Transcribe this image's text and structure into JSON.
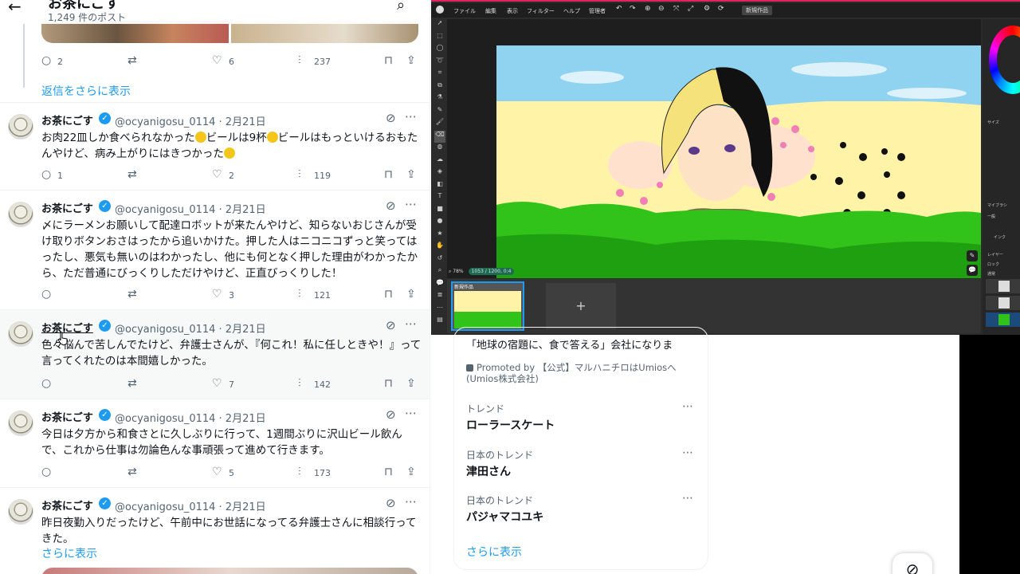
{
  "timeline": {
    "back_icon": "arrow-left-icon",
    "title": "お茶にごす",
    "post_count": "1,249 件のポスト",
    "search_icon": "search-icon",
    "top_actions": {
      "reply": "2",
      "repost": "",
      "like": "6",
      "views": "237"
    },
    "show_more_replies": "返信をさらに表示",
    "tweets": [
      {
        "name": "お茶にごす",
        "handle": "@ocyanigosu_0114 · 2月21日",
        "text_parts": [
          "お肉22皿しか食べられなかった",
          "ビールは9杯",
          "ビールはもっといけるおもたんやけど、病み上がりにはきつかった",
          ""
        ],
        "reply": "1",
        "repost": "",
        "like": "2",
        "views": "119"
      },
      {
        "name": "お茶にごす",
        "handle": "@ocyanigosu_0114 · 2月21日",
        "text": "〆にラーメンお願いして配達ロボットが来たんやけど、知らないおじさんが受け取りボタンおさはったから追いかけた。押した人はニコニコずっと笑ってはったし、悪気も無いのはわかったし、他にも何となく押した理由がわかったから、ただ普通にびっくりしただけやけど、正直びっくりした！",
        "reply": "",
        "repost": "",
        "like": "3",
        "views": "121"
      },
      {
        "name": "お茶にごす",
        "handle": "@ocyanigosu_0114 · 2月21日",
        "text": "色々悩んで苦しんでたけど、弁護士さんが、『何これ！私に任しときや！』って言ってくれたのは本間嬉しかった。",
        "reply": "",
        "repost": "",
        "like": "7",
        "views": "142"
      },
      {
        "name": "お茶にごす",
        "handle": "@ocyanigosu_0114 · 2月21日",
        "text": "今日は夕方から和食さとに久しぶりに行って、1週間ぶりに沢山ビール飲んで、これから仕事は勿論色んな事頑張って進めて行きます。",
        "reply": "",
        "repost": "",
        "like": "5",
        "views": "173"
      },
      {
        "name": "お茶にごす",
        "handle": "@ocyanigosu_0114 · 2月21日",
        "text": "昨日夜勤入りだったけど、午前中にお世話になってる弁護士さんに相談行ってきた。",
        "show_more": "さらに表示"
      }
    ]
  },
  "paint_app": {
    "menu": [
      "ファイル",
      "編集",
      "表示",
      "フィルター",
      "ヘルプ",
      "管理者"
    ],
    "document_tab": "新規作品",
    "zoom": "78%",
    "canvas_size": "1053 / 1200, 0:4",
    "film_thumb_label": "新規作品",
    "add_label": "+",
    "panel_labels": {
      "size": "サイズ",
      "my_brush": "マイブラシ",
      "general": "一般",
      "ink": "インク",
      "layer": "レイヤー",
      "lock": "ロック",
      "normal": "通常"
    },
    "colors": {
      "sky": "#8fd3f0",
      "field": "#fff3a8",
      "grass": "#31c31a",
      "accent": "#1d9bf0"
    }
  },
  "sidebar": {
    "promo_text": "「地球の宿題に、食で答える」会社になりま",
    "promoted_by": "Promoted by 【公式】マルハニチロはUmiosへ (Umios株式会社)",
    "trends": [
      {
        "category": "トレンド",
        "name": "ローラースケート"
      },
      {
        "category": "日本のトレンド",
        "name": "津田さん"
      },
      {
        "category": "日本のトレンド",
        "name": "パジャマコユキ"
      }
    ],
    "show_more": "さらに表示"
  }
}
